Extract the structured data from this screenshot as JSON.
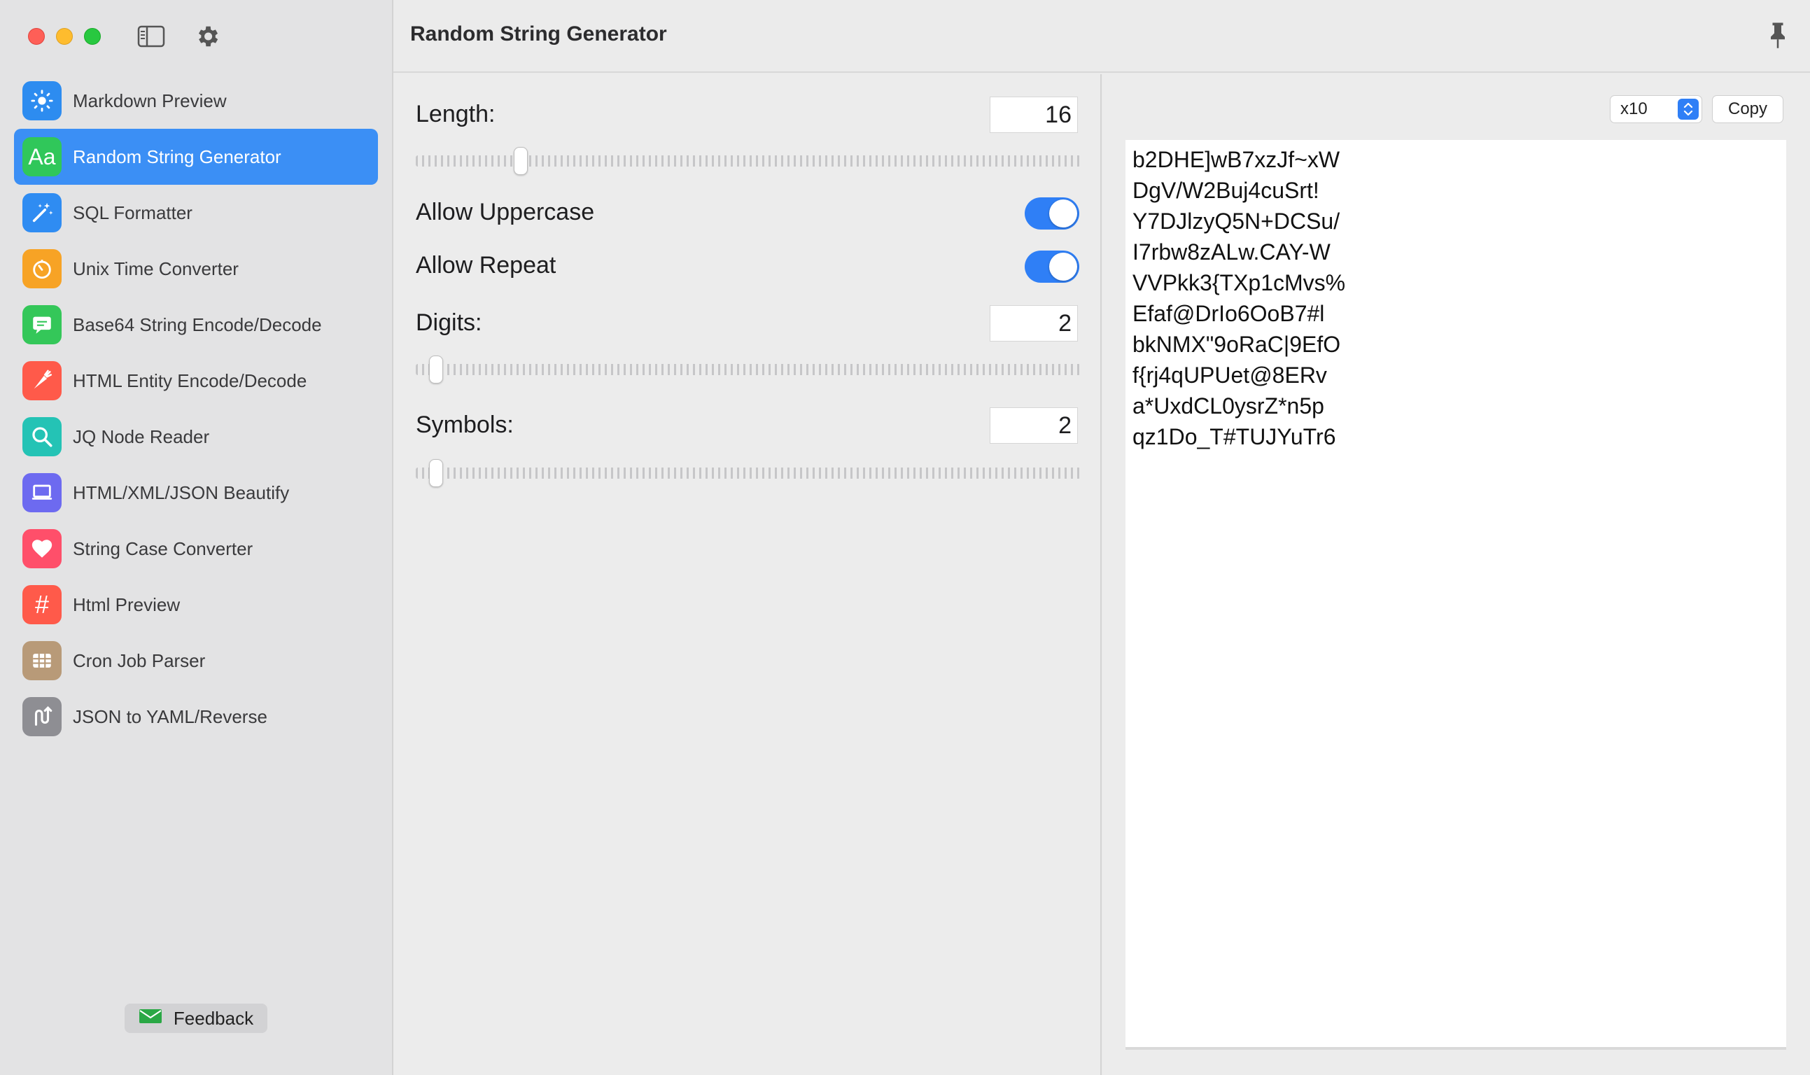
{
  "window": {
    "title": "Random String Generator"
  },
  "sidebar": {
    "items": [
      {
        "label": "Markdown Preview",
        "icon": "sun-icon",
        "color": "#2d8cf0",
        "active": false
      },
      {
        "label": "Random String Generator",
        "icon": "text-aa-icon",
        "color": "#30c75a",
        "active": true
      },
      {
        "label": "SQL Formatter",
        "icon": "magic-wand-icon",
        "color": "#2f8cf2",
        "active": false
      },
      {
        "label": "Unix Time Converter",
        "icon": "timer-icon",
        "color": "#f7a325",
        "active": false
      },
      {
        "label": "Base64 String Encode/Decode",
        "icon": "message-icon",
        "color": "#34c759",
        "active": false
      },
      {
        "label": "HTML Entity Encode/Decode",
        "icon": "carrot-icon",
        "color": "#ff5a4a",
        "active": false
      },
      {
        "label": "JQ Node Reader",
        "icon": "magnifier-icon",
        "color": "#24c3b5",
        "active": false
      },
      {
        "label": "HTML/XML/JSON Beautify",
        "icon": "laptop-icon",
        "color": "#6d6af0",
        "active": false
      },
      {
        "label": "String Case Converter",
        "icon": "heart-icon",
        "color": "#ff4f6a",
        "active": false
      },
      {
        "label": "Html Preview",
        "icon": "hash-icon",
        "color": "#ff5a4a",
        "active": false
      },
      {
        "label": "Cron Job Parser",
        "icon": "grid-icon",
        "color": "#b89a78",
        "active": false
      },
      {
        "label": "JSON to YAML/Reverse",
        "icon": "route-icon",
        "color": "#8e8e93",
        "active": false
      }
    ],
    "feedback_label": "Feedback"
  },
  "settings": {
    "length": {
      "label": "Length:",
      "value": "16",
      "slider_fraction": 0.15
    },
    "allow_uppercase": {
      "label": "Allow Uppercase",
      "on": true
    },
    "allow_repeat": {
      "label": "Allow Repeat",
      "on": true
    },
    "digits": {
      "label": "Digits:",
      "value": "2",
      "slider_fraction": 0.02
    },
    "symbols": {
      "label": "Symbols:",
      "value": "2",
      "slider_fraction": 0.02
    }
  },
  "output": {
    "count_label": "x10",
    "copy_label": "Copy",
    "lines": [
      "b2DHE]wB7xzJf~xW",
      "DgV/W2Buj4cuSrt!",
      "Y7DJlzyQ5N+DCSu/",
      "I7rbw8zALw.CAY-W",
      "VVPkk3{TXp1cMvs%",
      "Efaf@DrIo6OoB7#l",
      "bkNMX\"9oRaC|9EfO",
      "f{rj4qUPUet@8ERv",
      "a*UxdCL0ysrZ*n5p",
      "qz1Do_T#TUJYuTr6"
    ]
  },
  "colors": {
    "accent": "#3b8ff5",
    "toggle_on": "#2f7ff6"
  }
}
